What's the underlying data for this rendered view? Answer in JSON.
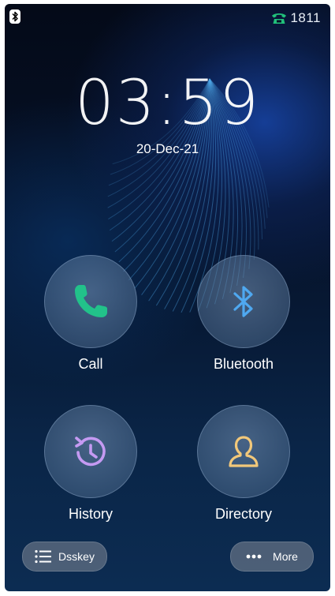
{
  "status_bar": {
    "bluetooth_icon": "bluetooth-icon",
    "line_icon": "handset-icon",
    "line_color": "#21c07a",
    "extension": "1811"
  },
  "clock": {
    "time": "03:59",
    "date": "20-Dec-21"
  },
  "tiles": [
    {
      "label": "Call",
      "icon": "phone-icon",
      "icon_color": "#22c28a"
    },
    {
      "label": "Bluetooth",
      "icon": "bluetooth-icon",
      "icon_color": "#4fa8f0"
    },
    {
      "label": "History",
      "icon": "history-icon",
      "icon_color": "#c59af2"
    },
    {
      "label": "Directory",
      "icon": "contact-icon",
      "icon_color": "#f2c87a"
    }
  ],
  "bottom_bar": {
    "dsskey_label": "Dsskey",
    "dsskey_icon": "list-icon",
    "more_label": "More",
    "more_icon": "more-dots-icon"
  }
}
